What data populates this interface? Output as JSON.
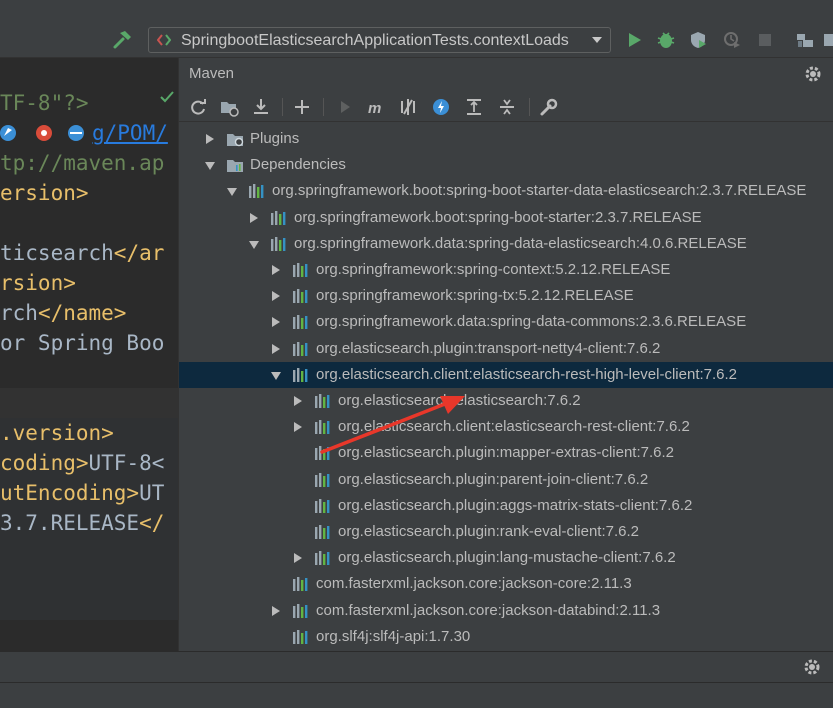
{
  "toolbar": {
    "run_config_label": "SpringbootElasticsearchApplicationTests.contextLoads",
    "icons": [
      "hammer-icon",
      "run-config-icon",
      "run-icon",
      "debug-icon",
      "coverage-icon",
      "profile-icon",
      "stop-icon",
      "project-structure-icon",
      "more-icon"
    ]
  },
  "editor": {
    "lines": [
      [
        "TF-8\"?>",
        ""
      ],
      [
        "",
        ""
      ],
      [
        "tp://maven.ap",
        ""
      ],
      [
        "ersion>",
        ""
      ],
      [
        "",
        ""
      ],
      [
        "ticsearch",
        "</ar"
      ],
      [
        "rsion>",
        ""
      ],
      [
        "rch",
        "</name>"
      ],
      [
        "or Spring Boo",
        ""
      ],
      [
        "",
        ""
      ],
      [
        "",
        ""
      ],
      [
        ".version>",
        ""
      ],
      [
        "coding>",
        "UTF-8<"
      ],
      [
        "utEncoding>",
        "UT"
      ],
      [
        "3.7.RELEASE",
        "</"
      ]
    ],
    "url_fragment": "g/POM/"
  },
  "maven": {
    "title": "Maven",
    "tree": [
      {
        "label": "Plugins",
        "indent": 0,
        "arrow": "right",
        "icon": "folder-plugins-icon"
      },
      {
        "label": "Dependencies",
        "indent": 0,
        "arrow": "down",
        "icon": "folder-deps-icon"
      },
      {
        "label": "org.springframework.boot:spring-boot-starter-data-elasticsearch:2.3.7.RELEASE",
        "indent": 1,
        "arrow": "down",
        "icon": "library-icon"
      },
      {
        "label": "org.springframework.boot:spring-boot-starter:2.3.7.RELEASE",
        "indent": 2,
        "arrow": "right",
        "icon": "library-icon"
      },
      {
        "label": "org.springframework.data:spring-data-elasticsearch:4.0.6.RELEASE",
        "indent": 2,
        "arrow": "down",
        "icon": "library-icon"
      },
      {
        "label": "org.springframework:spring-context:5.2.12.RELEASE",
        "indent": 3,
        "arrow": "right",
        "icon": "library-icon"
      },
      {
        "label": "org.springframework:spring-tx:5.2.12.RELEASE",
        "indent": 3,
        "arrow": "right",
        "icon": "library-icon"
      },
      {
        "label": "org.springframework.data:spring-data-commons:2.3.6.RELEASE",
        "indent": 3,
        "arrow": "right",
        "icon": "library-icon"
      },
      {
        "label": "org.elasticsearch.plugin:transport-netty4-client:7.6.2",
        "indent": 3,
        "arrow": "right",
        "icon": "library-icon"
      },
      {
        "label": "org.elasticsearch.client:elasticsearch-rest-high-level-client:7.6.2",
        "indent": 3,
        "arrow": "down",
        "icon": "library-icon",
        "selected": true
      },
      {
        "label": "org.elasticsearch:elasticsearch:7.6.2",
        "indent": 4,
        "arrow": "right",
        "icon": "library-icon"
      },
      {
        "label": "org.elasticsearch.client:elasticsearch-rest-client:7.6.2",
        "indent": 4,
        "arrow": "right",
        "icon": "library-icon"
      },
      {
        "label": "org.elasticsearch.plugin:mapper-extras-client:7.6.2",
        "indent": 4,
        "arrow": "none",
        "icon": "library-icon"
      },
      {
        "label": "org.elasticsearch.plugin:parent-join-client:7.6.2",
        "indent": 4,
        "arrow": "none",
        "icon": "library-icon"
      },
      {
        "label": "org.elasticsearch.plugin:aggs-matrix-stats-client:7.6.2",
        "indent": 4,
        "arrow": "none",
        "icon": "library-icon"
      },
      {
        "label": "org.elasticsearch.plugin:rank-eval-client:7.6.2",
        "indent": 4,
        "arrow": "none",
        "icon": "library-icon"
      },
      {
        "label": "org.elasticsearch.plugin:lang-mustache-client:7.6.2",
        "indent": 4,
        "arrow": "right",
        "icon": "library-icon"
      },
      {
        "label": "com.fasterxml.jackson.core:jackson-core:2.11.3",
        "indent": 3,
        "arrow": "none",
        "icon": "library-icon"
      },
      {
        "label": "com.fasterxml.jackson.core:jackson-databind:2.11.3",
        "indent": 3,
        "arrow": "right",
        "icon": "library-icon"
      },
      {
        "label": "org.slf4j:slf4j-api:1.7.30",
        "indent": 3,
        "arrow": "none",
        "icon": "library-icon"
      }
    ]
  },
  "colors": {
    "toolbar_bg": "#3c3f41",
    "editor_bg": "#2b2b2b",
    "selection": "#0d293e",
    "run_green": "#59a869",
    "annotation_red": "#e8372a"
  }
}
